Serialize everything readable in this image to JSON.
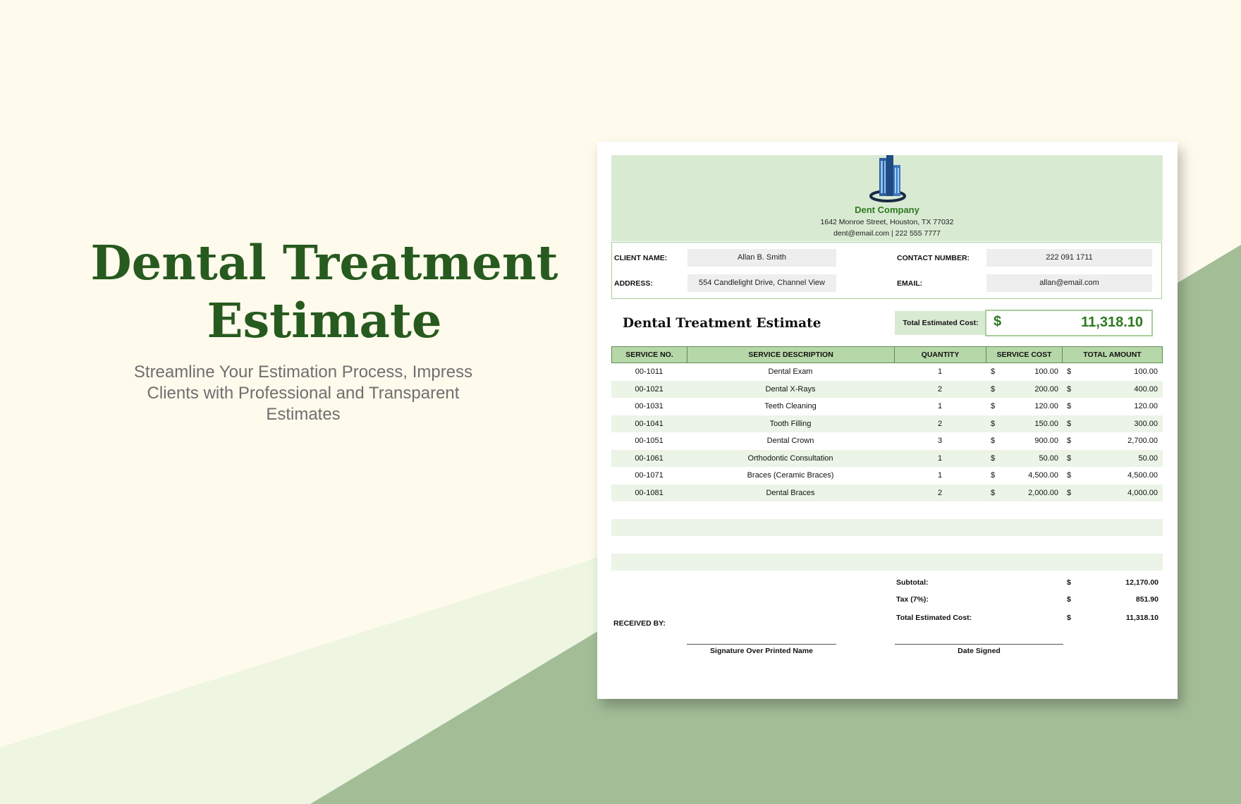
{
  "promo": {
    "title_line1": "Dental Treatment",
    "title_line2": "Estimate",
    "subtitle": "Streamline Your Estimation Process, Impress Clients with Professional and Transparent Estimates"
  },
  "company": {
    "name": "Dent Company",
    "address": "1642 Monroe Street, Houston, TX 77032",
    "contact": "dent@email.com | 222 555 7777",
    "logo_icon": "building-logo-icon"
  },
  "client": {
    "name_label": "CLIENT NAME:",
    "name": "Allan B. Smith",
    "address_label": "ADDRESS:",
    "address": "554 Candlelight Drive, Channel View",
    "contact_label": "CONTACT NUMBER:",
    "contact": "222 091 1711",
    "email_label": "EMAIL:",
    "email": "allan@email.com"
  },
  "estimate": {
    "title": "Dental Treatment Estimate",
    "total_label": "Total Estimated Cost:",
    "currency": "$",
    "total_value": "11,318.10"
  },
  "table": {
    "headers": [
      "SERVICE NO.",
      "SERVICE DESCRIPTION",
      "QUANTITY",
      "SERVICE COST",
      "TOTAL AMOUNT"
    ],
    "rows": [
      {
        "no": "00-1011",
        "desc": "Dental Exam",
        "qty": "1",
        "cost": "100.00",
        "total": "100.00"
      },
      {
        "no": "00-1021",
        "desc": "Dental X-Rays",
        "qty": "2",
        "cost": "200.00",
        "total": "400.00"
      },
      {
        "no": "00-1031",
        "desc": "Teeth Cleaning",
        "qty": "1",
        "cost": "120.00",
        "total": "120.00"
      },
      {
        "no": "00-1041",
        "desc": "Tooth Filling",
        "qty": "2",
        "cost": "150.00",
        "total": "300.00"
      },
      {
        "no": "00-1051",
        "desc": "Dental Crown",
        "qty": "3",
        "cost": "900.00",
        "total": "2,700.00"
      },
      {
        "no": "00-1061",
        "desc": "Orthodontic Consultation",
        "qty": "1",
        "cost": "50.00",
        "total": "50.00"
      },
      {
        "no": "00-1071",
        "desc": "Braces (Ceramic Braces)",
        "qty": "1",
        "cost": "4,500.00",
        "total": "4,500.00"
      },
      {
        "no": "00-1081",
        "desc": "Dental Braces",
        "qty": "2",
        "cost": "2,000.00",
        "total": "4,000.00"
      }
    ]
  },
  "summary": {
    "subtotal_label": "Subtotal:",
    "subtotal": "12,170.00",
    "tax_label": "Tax (7%):",
    "tax": "851.90",
    "total_label": "Total Estimated Cost:",
    "total": "11,318.10"
  },
  "signature": {
    "received_by": "RECEIVED BY:",
    "signature_label": "Signature Over Printed Name",
    "date_label": "Date Signed"
  },
  "colors": {
    "background": "#fefaec",
    "light_green": "#d9ead3",
    "mid_green": "#a3bd97",
    "title_green": "#275a1f"
  }
}
